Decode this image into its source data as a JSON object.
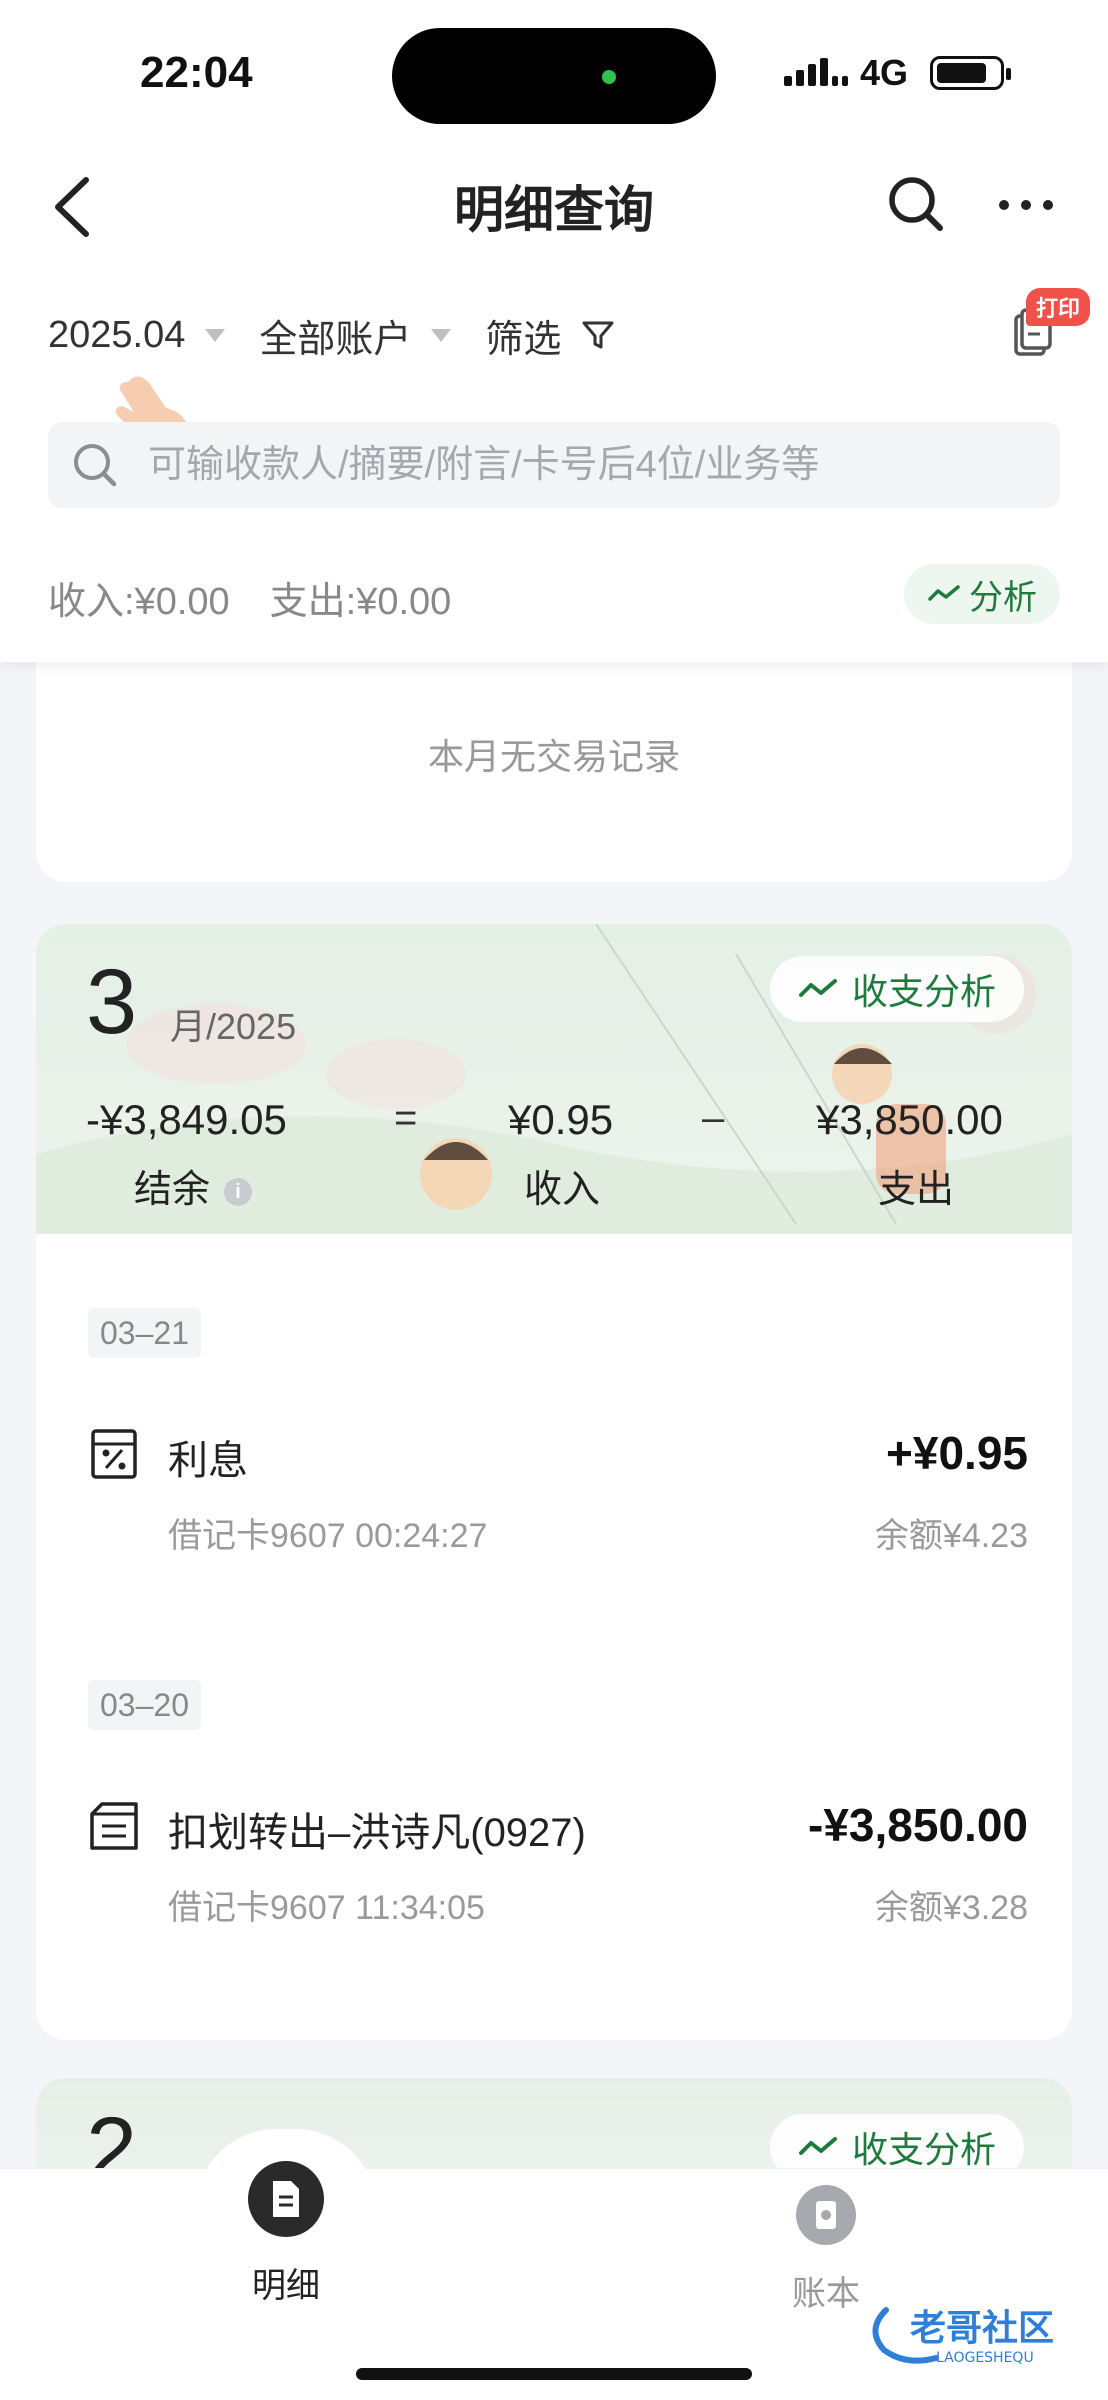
{
  "status": {
    "time": "22:04",
    "network": "4G"
  },
  "header": {
    "title": "明细查询",
    "date_filter": "2025.04",
    "account_filter": "全部账户",
    "filter_label": "筛选",
    "print_badge": "打印",
    "search_placeholder": "可输收款人/摘要/附言/卡号后4位/业务等",
    "income_summary": "收入:¥0.00",
    "expense_summary": "支出:¥0.00",
    "analysis_label": "分析"
  },
  "empty_month": {
    "message": "本月无交易记录"
  },
  "month_card": {
    "month": "3",
    "year_suffix": "月/2025",
    "analysis_label": "收支分析",
    "balance_value": "-¥3,849.05",
    "balance_label": "结余",
    "equals": "=",
    "income_value": "¥0.95",
    "income_label": "收入",
    "minus": "–",
    "expense_value": "¥3,850.00",
    "expense_label": "支出",
    "info_glyph": "i",
    "groups": [
      {
        "date": "03–21",
        "transactions": [
          {
            "name": "利息",
            "sub": "借记卡9607 00:24:27",
            "amount": "+¥0.95",
            "balance": "余额¥4.23",
            "icon": "interest-icon"
          }
        ]
      },
      {
        "date": "03–20",
        "transactions": [
          {
            "name": "扣划转出–洪诗凡(0927)",
            "sub": "借记卡9607 11:34:05",
            "amount": "-¥3,850.00",
            "balance": "余额¥3.28",
            "icon": "transfer-icon"
          }
        ]
      }
    ]
  },
  "next_card": {
    "month": "2",
    "analysis_label": "收支分析"
  },
  "tabbar": {
    "tabs": [
      {
        "label": "明细",
        "active": true
      },
      {
        "label": "账本",
        "active": false
      }
    ]
  },
  "watermark": {
    "text": "老哥社区",
    "sub": "LAOGESHEQU"
  },
  "colors": {
    "accent_green": "#1f7a3e",
    "badge_red": "#f0514a"
  }
}
